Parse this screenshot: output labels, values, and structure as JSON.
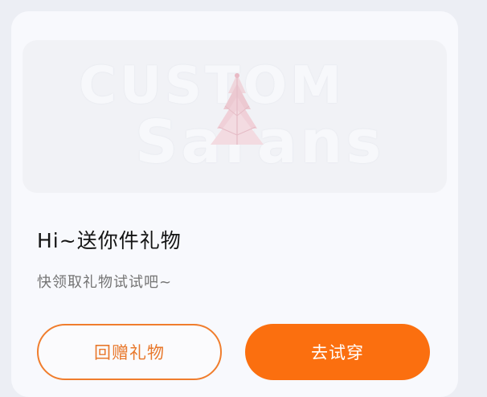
{
  "card": {
    "banner": {
      "watermark_top": "CUSTOM",
      "watermark_bottom": "Sarans",
      "image_icon": "christmas-tree-icon"
    },
    "title": "Hi~送你件礼物",
    "subtitle": "快领取礼物试试吧~",
    "buttons": {
      "gift_back_label": "回赠礼物",
      "try_on_label": "去试穿"
    }
  },
  "colors": {
    "accent_orange": "#fb6f0f",
    "outline_orange": "#f07d2d",
    "card_background": "#f8f9fd",
    "page_background": "#eceef4"
  }
}
